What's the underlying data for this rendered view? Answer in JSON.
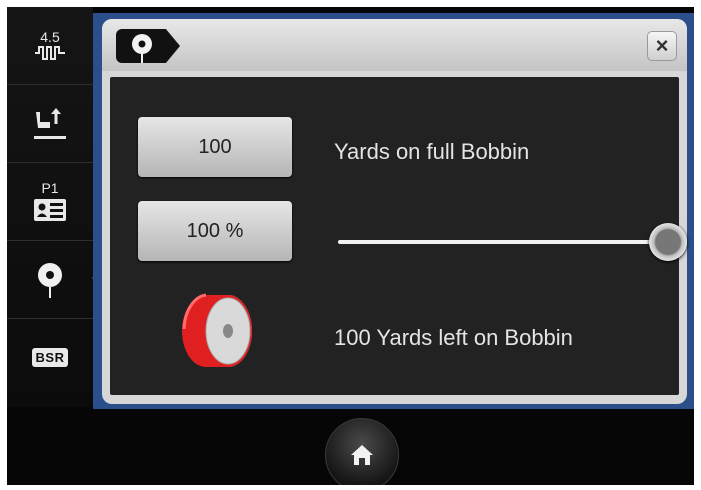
{
  "sidebar": {
    "items": [
      {
        "label": "4.5",
        "icon": "stitch-width-icon"
      },
      {
        "label": "",
        "icon": "presser-foot-lift-icon"
      },
      {
        "label": "P1",
        "icon": "personal-program-icon"
      },
      {
        "label": "",
        "icon": "bobbin-icon"
      },
      {
        "label": "BSR",
        "icon": "bsr-icon"
      }
    ]
  },
  "window": {
    "tab_icon": "bobbin-icon",
    "close_label": "×"
  },
  "bobbin": {
    "full_value": "100",
    "full_label": "Yards on full Bobbin",
    "percent_value": "100 %",
    "percent_level": 100,
    "left_label": "100 Yards left on Bobbin"
  },
  "colors": {
    "panel_frame": "#2b4f8a",
    "bobbin_red": "#e02020"
  },
  "bottom": {
    "home_icon": "home-icon"
  }
}
